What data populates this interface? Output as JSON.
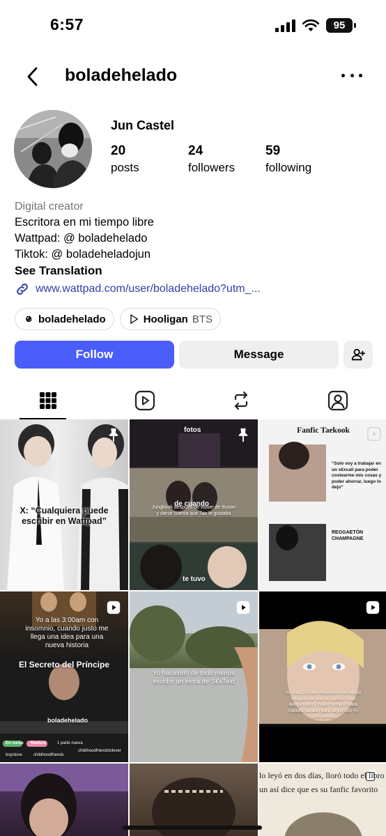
{
  "status_bar": {
    "time": "6:57",
    "battery": "95"
  },
  "header": {
    "username": "boladehelado"
  },
  "profile": {
    "display_name": "Jun Castel",
    "stats": [
      {
        "value": "20",
        "label": "posts"
      },
      {
        "value": "24",
        "label": "followers"
      },
      {
        "value": "59",
        "label": "following"
      }
    ],
    "category": "Digital creator",
    "bio_lines": [
      "Escritora en mi tiempo libre",
      "Wattpad: @ boladehelado",
      "Tiktok: @ boladeheladojun"
    ],
    "see_translation": "See Translation",
    "link": "www.wattpad.com/user/boladehelado?utm_..."
  },
  "chips": {
    "threads_label": "boladehelado",
    "music_title": "Hooligan",
    "music_artist": "BTS"
  },
  "buttons": {
    "follow": "Follow",
    "message": "Message"
  },
  "icons": {
    "back": "chevron-left-icon",
    "more": "more-horizontal-icon",
    "threads": "threads-icon",
    "play": "play-icon",
    "link": "link-icon",
    "add_user": "add-user-icon",
    "grid": "grid-icon",
    "reels": "reels-icon",
    "reposts": "repost-icon",
    "tagged": "tagged-icon",
    "pin": "pin-icon"
  },
  "colors": {
    "accent": "#4a5df9",
    "link": "#2f3fa8"
  },
  "grid_posts": [
    {
      "texts": [
        "X: “Cualquiera puede escribir en Wattpad”"
      ]
    },
    {
      "texts": [
        "fotos",
        "de cuando",
        "Jungkook después de volver de Busan y darse cuenta que Tae le gustaba",
        "te tuvo"
      ]
    },
    {
      "texts": [
        "Fanfic Taekook",
        "“Solo voy a trabajar en un s€xcali para poder costearme mis cosas y poder ahorrar, luego lo dejo”",
        "REGGAETÓN CHAMPAGNE"
      ]
    },
    {
      "texts": [
        "Yo a las 3:00am con insomnio, cuando justo me llega una idea para una nueva historia",
        "El Secreto del Príncipe",
        "boladehelado",
        "En curso",
        "Madura",
        "1 parte nueva",
        "boyslove",
        "childhoodfriends",
        "childhoodfriendstolover"
      ]
    },
    {
      "texts": [
        "Yo haciendo de todo menos escribir un extra de S€xText"
      ]
    },
    {
      "texts": [
        "Yo a las 3:00am mirándome al espejo después de leer el capítulo más desgarrador y hacer como si nada hubiera pasado para seguir con mi vida adulta"
      ]
    },
    {
      "texts": []
    },
    {
      "texts": []
    },
    {
      "texts": [
        "lo leyó en dos días, lloró todo el libro",
        "un así dice que es su fanfic favorito"
      ]
    }
  ]
}
